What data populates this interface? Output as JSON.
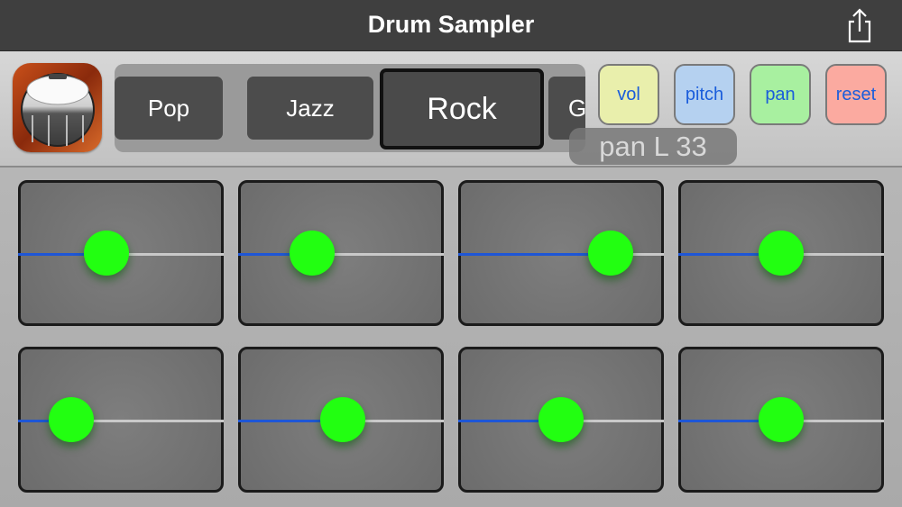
{
  "navbar": {
    "title": "Drum Sampler",
    "share_icon": "share-icon"
  },
  "presets": {
    "items": [
      "Pop",
      "Jazz",
      "Rock",
      "G"
    ],
    "selected": "Rock"
  },
  "controls": {
    "vol": {
      "label": "vol",
      "color": "#e9efac"
    },
    "pitch": {
      "label": "pitch",
      "color": "#b5d1f0"
    },
    "pan": {
      "label": "pan",
      "color": "#a8f0a0"
    },
    "reset": {
      "label": "reset",
      "color": "#fbaaa0"
    }
  },
  "readout": "pan L 33",
  "colors": {
    "accent": "#1a5ddb",
    "knob": "#22ff11",
    "track_fill": "#1e56d6"
  },
  "pads": [
    {
      "pan_fraction": 0.43
    },
    {
      "pan_fraction": 0.36
    },
    {
      "pan_fraction": 0.74
    },
    {
      "pan_fraction": 0.5
    },
    {
      "pan_fraction": 0.26
    },
    {
      "pan_fraction": 0.51
    },
    {
      "pan_fraction": 0.5
    },
    {
      "pan_fraction": 0.5
    }
  ]
}
